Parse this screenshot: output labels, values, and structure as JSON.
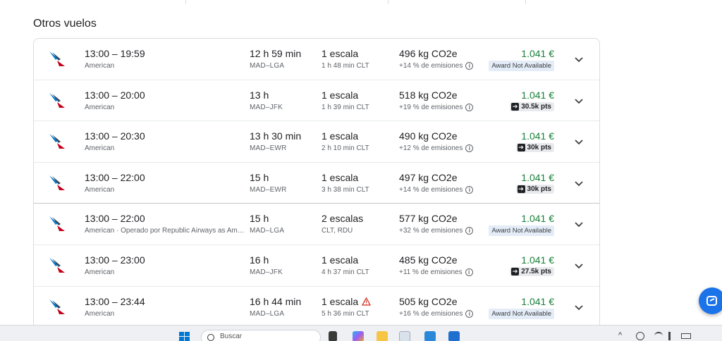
{
  "section_title": "Otros vuelos",
  "flights": [
    {
      "times": "13:00 – 19:59",
      "airline": "American",
      "duration": "12 h 59 min",
      "route": "MAD–LGA",
      "stops": "1 escala",
      "layover": "1 h 48 min CLT",
      "warning": false,
      "emissions": "496 kg CO2e",
      "emissions_delta": "+14 % de emisiones",
      "price": "1.041 €",
      "award_type": "unavailable",
      "award_label": "Award Not Available"
    },
    {
      "times": "13:00 – 20:00",
      "airline": "American",
      "duration": "13 h",
      "route": "MAD–JFK",
      "stops": "1 escala",
      "layover": "1 h 39 min CLT",
      "warning": false,
      "emissions": "518 kg CO2e",
      "emissions_delta": "+19 % de emisiones",
      "price": "1.041 €",
      "award_type": "points",
      "award_label": "30.5k pts"
    },
    {
      "times": "13:00 – 20:30",
      "airline": "American",
      "duration": "13 h 30 min",
      "route": "MAD–EWR",
      "stops": "1 escala",
      "layover": "2 h 10 min CLT",
      "warning": false,
      "emissions": "490 kg CO2e",
      "emissions_delta": "+12 % de emisiones",
      "price": "1.041 €",
      "award_type": "points",
      "award_label": "30k pts"
    },
    {
      "times": "13:00 – 22:00",
      "airline": "American",
      "duration": "15 h",
      "route": "MAD–EWR",
      "stops": "1 escala",
      "layover": "3 h 38 min CLT",
      "warning": false,
      "emissions": "497 kg CO2e",
      "emissions_delta": "+14 % de emisiones",
      "price": "1.041 €",
      "award_type": "points",
      "award_label": "30k pts"
    },
    {
      "times": "13:00 – 22:00",
      "airline": "American · Operado por Republic Airways as American Eagle",
      "duration": "15 h",
      "route": "MAD–LGA",
      "stops": "2 escalas",
      "layover": "CLT, RDU",
      "warning": false,
      "emissions": "577 kg CO2e",
      "emissions_delta": "+32 % de emisiones",
      "price": "1.041 €",
      "award_type": "unavailable",
      "award_label": "Award Not Available"
    },
    {
      "times": "13:00 – 23:00",
      "airline": "American",
      "duration": "16 h",
      "route": "MAD–JFK",
      "stops": "1 escala",
      "layover": "4 h 37 min CLT",
      "warning": false,
      "emissions": "485 kg CO2e",
      "emissions_delta": "+11 % de emisiones",
      "price": "1.041 €",
      "award_type": "points",
      "award_label": "27.5k pts"
    },
    {
      "times": "13:00 – 23:44",
      "airline": "American",
      "duration": "16 h 44 min",
      "route": "MAD–LGA",
      "stops": "1 escala",
      "layover": "5 h 36 min CLT",
      "warning": true,
      "emissions": "505 kg CO2e",
      "emissions_delta": "+16 % de emisiones",
      "price": "1.041 €",
      "award_type": "unavailable",
      "award_label": "Award Not Available"
    }
  ],
  "colors": {
    "price": "#188038",
    "accent": "#1a73e8"
  },
  "icons": {
    "airline_logo": "american-airlines-logo",
    "expand": "chevron-down-icon",
    "info": "info-icon",
    "warning": "warning-icon",
    "points": "arrow-right-icon"
  },
  "taskbar": {
    "search_placeholder": "Buscar"
  }
}
